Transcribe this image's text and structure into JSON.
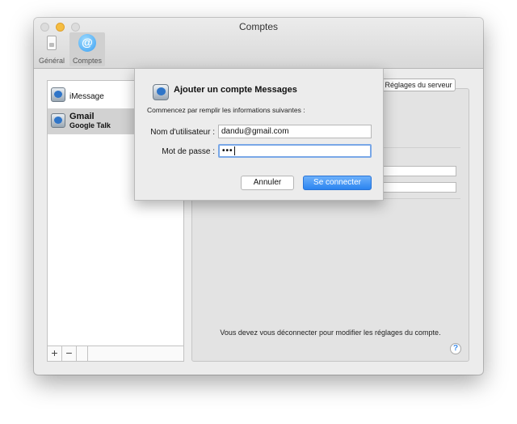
{
  "window": {
    "title": "Comptes"
  },
  "toolbar": {
    "items": [
      {
        "label": "Général",
        "icon": "switch-icon"
      },
      {
        "label": "Comptes",
        "icon": "at-icon",
        "active": true
      }
    ]
  },
  "sidebar": {
    "accounts": [
      {
        "name": "iMessage"
      },
      {
        "name": "Gmail",
        "subtitle": "Google Talk",
        "selected": true
      }
    ],
    "add_label": "+",
    "remove_label": "−"
  },
  "detail": {
    "server_tab_label": "Réglages du serveur",
    "disconnect_message": "Vous devez vous déconnecter pour modifier les réglages du compte.",
    "help_label": "?"
  },
  "sheet": {
    "title": "Ajouter un compte Messages",
    "subtitle": "Commencez par remplir les informations suivantes :",
    "username_label": "Nom d'utilisateur :",
    "username_value": "dandu@gmail.com",
    "password_label": "Mot de passe :",
    "password_value": "•••",
    "cancel_label": "Annuler",
    "connect_label": "Se connecter"
  },
  "colors": {
    "accent": "#2b84f0",
    "minimize": "#f5bd41",
    "selection": "#d2d2d2"
  }
}
